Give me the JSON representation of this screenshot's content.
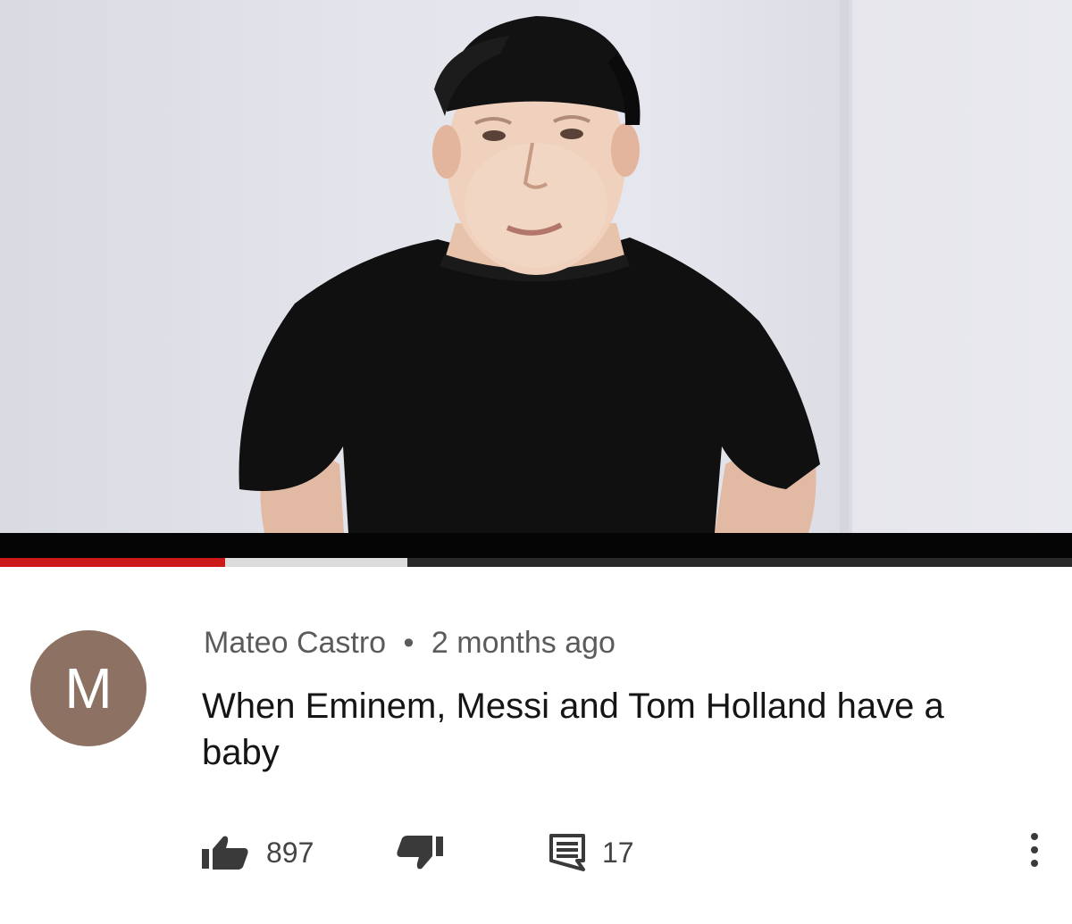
{
  "video": {
    "progress_played": 0.21,
    "progress_buffered": 0.38
  },
  "comment": {
    "avatar_letter": "M",
    "author": "Mateo Castro",
    "separator": "•",
    "time_ago": "2 months ago",
    "text": "When Eminem, Messi and Tom Holland have a baby",
    "likes": "897",
    "replies": "17"
  },
  "icons": {
    "like": "thumbs-up-icon",
    "dislike": "thumbs-down-icon",
    "reply": "comment-icon",
    "more": "more-vertical-icon"
  },
  "colors": {
    "avatar_bg": "#8d7162",
    "progress_played": "#cc1a1a",
    "shirt": "#101010"
  }
}
